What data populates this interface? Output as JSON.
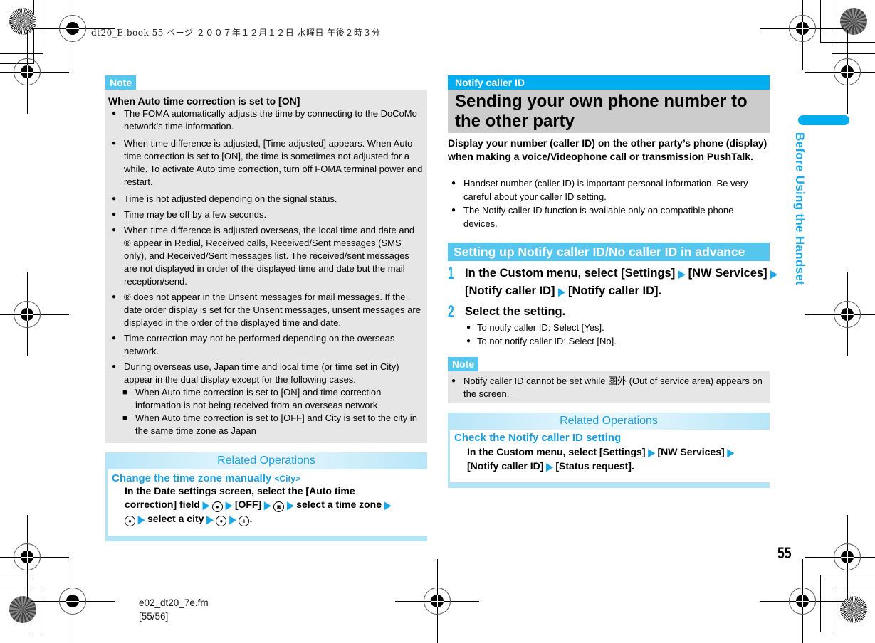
{
  "header": {
    "print_info": "dt20_E.book  55 ページ  ２００７年１２月１２日  水曜日  午後２時３分"
  },
  "left": {
    "note_tag": "Note",
    "note_title": "When Auto time correction is set to [ON]",
    "bullets": [
      "The FOMA automatically adjusts the time by connecting to the DoCoMo network’s time information.",
      "When time difference is adjusted, [Time adjusted] appears. When Auto time correction is set to [ON], the time is sometimes not adjusted for a while. To activate Auto time correction, turn off FOMA terminal power and restart.",
      "Time is not adjusted depending on the signal status.",
      "Time may be off by a few seconds.",
      "When time difference is adjusted overseas, the local time and date and ® appear in Redial, Received calls, Received/Sent messages (SMS only), and Received/Sent messages list. The received/sent messages are not displayed in order of the displayed time and date but the mail reception/send.",
      "® does not appear in the Unsent messages for mail messages. If the date order display is set for the Unsent messages, unsent messages are displayed in the order of the displayed time and date.",
      "Time correction may not be performed depending on the overseas network.",
      "During overseas use, Japan time and local time (or time set in City) appear in the dual display except for the following cases."
    ],
    "sub_bullets": [
      "When Auto time correction is set to [ON] and time correction information is not being received from an overseas network",
      "When Auto time correction is set to [OFF] and City is set to the city in the same time zone as Japan"
    ],
    "related": {
      "header": "Related Operations",
      "title": "Change the time zone manually",
      "title_tag": "<City>",
      "line1": "In the Date settings screen, select the [Auto time",
      "line2_a": "correction] field",
      "line2_b": "[OFF]",
      "line2_c": "select a time zone",
      "line3_a": "select a city",
      "line3_end": ".",
      "keys": {
        "center": "●",
        "camera": "◙",
        "info": "i"
      }
    }
  },
  "right": {
    "section_tag": "Notify caller ID",
    "section_title": "Sending your own phone number to the other party",
    "intro": "Display your number (caller ID) on the other party’s phone (display) when making a voice/Videophone call or transmission PushTalk.",
    "bullets": [
      "Handset number (caller ID) is important personal information. Be very careful about your caller ID setting.",
      "The Notify caller ID function is available only on compatible phone devices."
    ],
    "subhead": "Setting up Notify caller ID/No caller ID in advance",
    "steps": [
      {
        "num": "1",
        "parts": [
          "In the Custom menu, select [Settings]",
          "[NW Services]",
          "[Notify caller ID]",
          "[Notify caller ID]."
        ]
      },
      {
        "num": "2",
        "parts": [
          "Select the setting."
        ]
      }
    ],
    "step2_bullets": [
      "To notify caller ID: Select [Yes].",
      "To not notify caller ID: Select [No]."
    ],
    "note_tag": "Note",
    "note_bullet": "Notify caller ID cannot be set while 圏外 (Out of service area) appears on the screen.",
    "related": {
      "header": "Related Operations",
      "title": "Check the Notify caller ID setting",
      "parts": [
        "In the Custom menu, select [Settings]",
        "[NW Services]",
        "[Notify caller ID]",
        "[Status request]."
      ]
    }
  },
  "sidebar": {
    "chapter": "Before Using the Handset"
  },
  "page_number": "55",
  "footer": {
    "file": "e02_dt20_7e.fm",
    "pages": "[55/56]"
  },
  "colors": {
    "accent": "#00aeef",
    "light_accent": "#55c7ef",
    "note_bg": "#e6e6e6",
    "title_bg": "#cccccc"
  }
}
